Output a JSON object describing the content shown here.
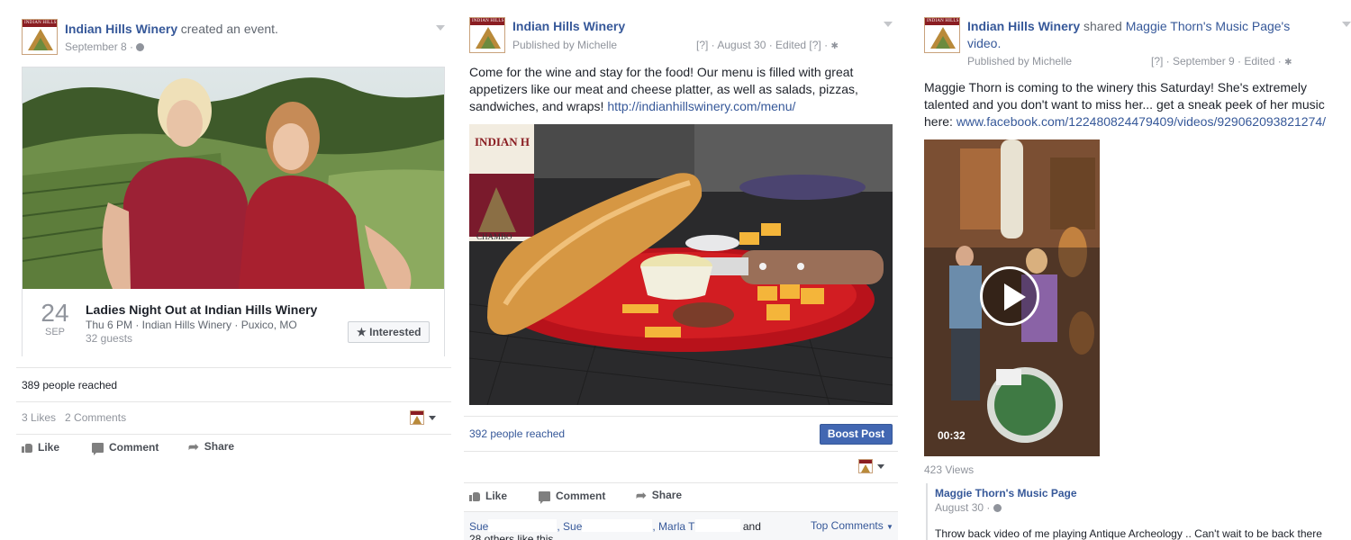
{
  "post1": {
    "page_name": "Indian Hills Winery",
    "action_text": "created an ",
    "action_link": "event.",
    "date": "September 8 ·",
    "event": {
      "day": "24",
      "month": "SEP",
      "title": "Ladies Night Out at Indian Hills Winery",
      "details": "Thu 6 PM · Indian Hills Winery · Puxico, MO",
      "guests": "32 guests",
      "interested_label": "Interested"
    },
    "reach": "389 people reached",
    "likes": "3 Likes",
    "comments": "2 Comments",
    "actions": {
      "like": "Like",
      "comment": "Comment",
      "share": "Share"
    }
  },
  "post2": {
    "page_name": "Indian Hills Winery",
    "published_by": "Published by Michelle",
    "meta_right": "[?] · August 30 · Edited [?] ·",
    "body": "Come for the wine and stay for the food! Our menu is filled with great appetizers like our meat and cheese platter, as well as salads, pizzas, sandwiches, and wraps!",
    "link": "http://indianhillswinery.com/menu/",
    "reach": "392 people reached",
    "boost_label": "Boost Post",
    "actions": {
      "like": "Like",
      "comment": "Comment",
      "share": "Share"
    },
    "likers": {
      "name1": "Sue",
      "name2": ", Sue",
      "name3": ", Marla T",
      "and": "and",
      "others": "28 others like this."
    },
    "top_comments": "Top Comments"
  },
  "post3": {
    "page_name": "Indian Hills Winery",
    "shared_text": " shared ",
    "shared_link": "Maggie Thorn's Music Page's",
    "video_word": "video.",
    "published_by": "Published by Michelle",
    "meta_right": "[?] · September 9 · Edited ·",
    "body": "Maggie Thorn is coming to the winery this Saturday! She's extremely talented and you don't want to miss her... get a sneak peek of her music here:",
    "link": "www.facebook.com/122480824479409/videos/929062093821274/",
    "video_duration": "00:32",
    "views": "423 Views",
    "shared_page": "Maggie Thorn's Music Page",
    "shared_date": "August 30 ·",
    "shared_text_body": "Throw back video of me playing Antique Archeology .. Can't wait to be back there"
  },
  "colors": {
    "link": "#365899",
    "boost": "#4267b2",
    "meta": "#90949c"
  }
}
